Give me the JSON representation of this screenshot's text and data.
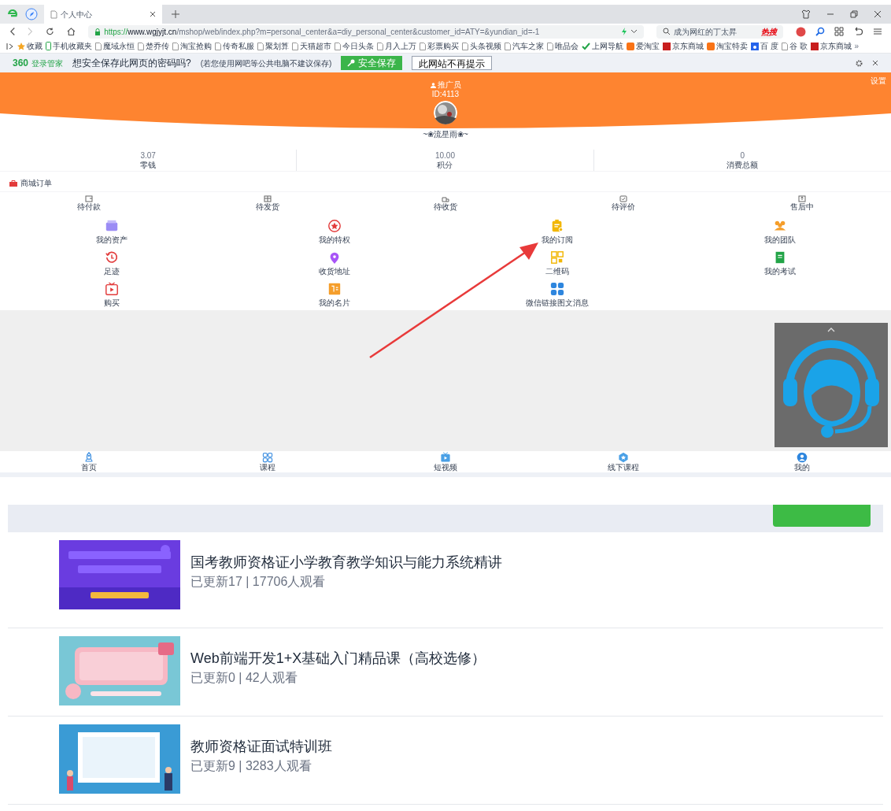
{
  "browser": {
    "tab_title": "个人中心",
    "url": {
      "scheme": "https://",
      "host": "www.wgjyjt.cn",
      "path": "/mshop/web/index.php?m=personal_center&a=diy_personal_center&customer_id=ATY=&yundian_id=-1"
    },
    "search": {
      "value": "成为网红的丁太昇",
      "hot": "热搜"
    },
    "bookmarks": [
      {
        "label": "收藏",
        "kind": "star"
      },
      {
        "label": "手机收藏夹",
        "kind": "phone"
      },
      {
        "label": "魔域永恒",
        "kind": "page"
      },
      {
        "label": "楚乔传",
        "kind": "page"
      },
      {
        "label": "淘宝抢购",
        "kind": "page"
      },
      {
        "label": "传奇私服",
        "kind": "page"
      },
      {
        "label": "聚划算",
        "kind": "page"
      },
      {
        "label": "天猫超市",
        "kind": "page"
      },
      {
        "label": "今日头条",
        "kind": "page"
      },
      {
        "label": "月入上万",
        "kind": "page"
      },
      {
        "label": "彩票购买",
        "kind": "page"
      },
      {
        "label": "头条视频",
        "kind": "page"
      },
      {
        "label": "汽车之家",
        "kind": "page"
      },
      {
        "label": "唯品会",
        "kind": "page"
      },
      {
        "label": "上网导航",
        "kind": "check"
      },
      {
        "label": "爱淘宝",
        "kind": "orange"
      },
      {
        "label": "京东商城",
        "kind": "red"
      },
      {
        "label": "淘宝特卖",
        "kind": "orange"
      },
      {
        "label": "百 度",
        "kind": "blue"
      },
      {
        "label": "谷 歌",
        "kind": "page"
      },
      {
        "label": "京东商城",
        "kind": "red"
      }
    ],
    "bookmarks_more": "»",
    "password_bar": {
      "brand": "360",
      "brand_sub": "登录管家",
      "question": "想安全保存此网页的密码吗?",
      "hint": "(若您使用网吧等公共电脑不建议保存)",
      "save": "安全保存",
      "never": "此网站不再提示"
    }
  },
  "page": {
    "settings": "设置",
    "role": "推广员",
    "id": "ID:4113",
    "nickname": "~❀流星雨❀~",
    "stats": [
      {
        "value": "3.07",
        "label": "零钱"
      },
      {
        "value": "10.00",
        "label": "积分"
      },
      {
        "value": "0",
        "label": "消费总额"
      }
    ],
    "orders_title": "商城订单",
    "orders": [
      "待付款",
      "待发货",
      "待收货",
      "待评价",
      "售后中"
    ],
    "tools": [
      "我的资产",
      "我的特权",
      "我的订阅",
      "我的团队",
      "足迹",
      "收货地址",
      "二维码",
      "我的考试",
      "购买",
      "我的名片",
      "微信链接图文消息"
    ],
    "nav": [
      "首页",
      "课程",
      "短视频",
      "线下课程",
      "我的"
    ]
  },
  "courses": [
    {
      "title": "国考教师资格证小学教育教学知识与能力系统精讲",
      "meta": "已更新17 | 17706人观看"
    },
    {
      "title": "Web前端开发1+X基础入门精品课（高校选修）",
      "meta": "已更新0 | 42人观看"
    },
    {
      "title": "教师资格证面试特训班",
      "meta": "已更新9 | 3283人观看"
    }
  ]
}
